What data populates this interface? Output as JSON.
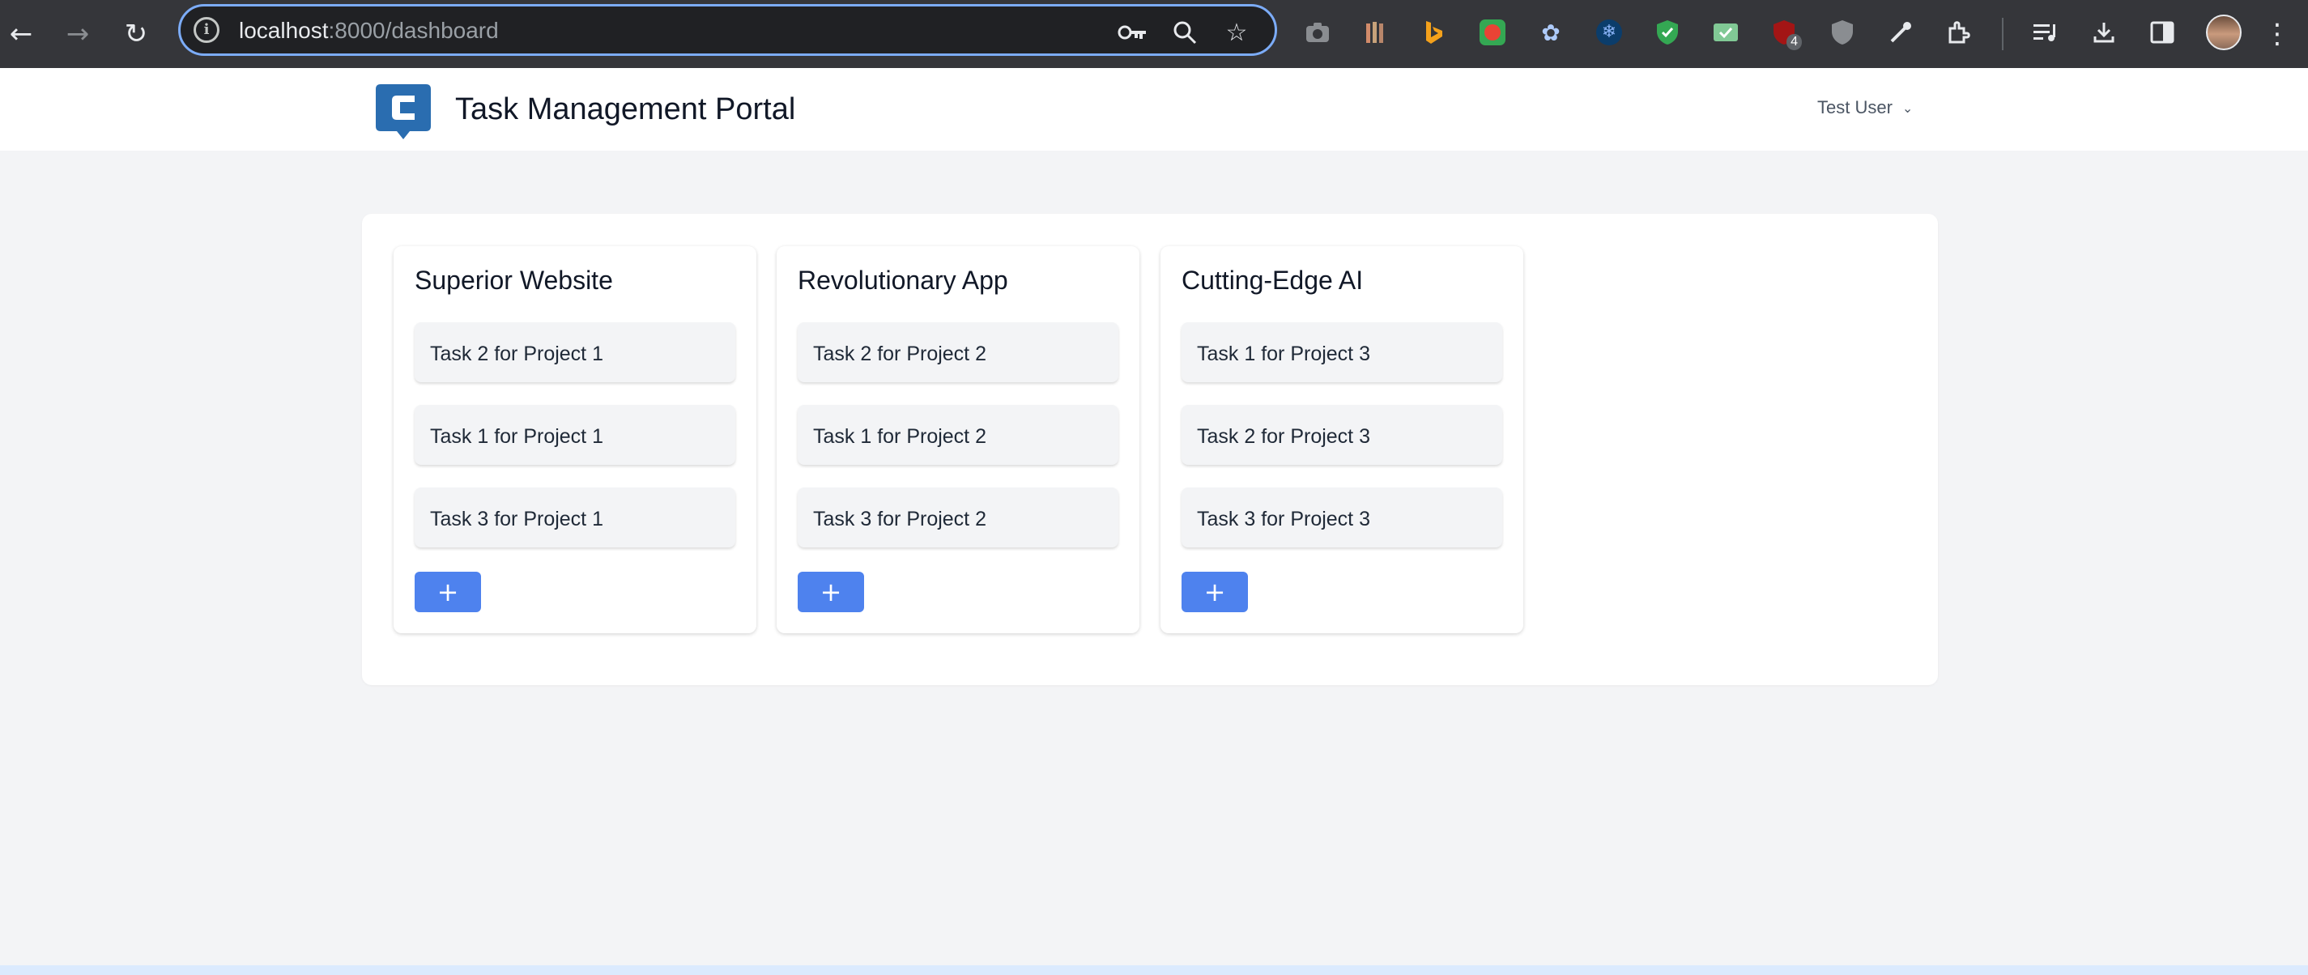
{
  "browser": {
    "url_host": "localhost",
    "url_path": ":8000/dashboard",
    "extension_badge": "4"
  },
  "header": {
    "title": "Task Management Portal",
    "user_name": "Test User",
    "brand_color": "#2a6db0"
  },
  "board": {
    "add_label": "+",
    "accent_color": "#4e82ee",
    "columns": [
      {
        "title": "Superior Website",
        "tasks": [
          "Task 2 for Project 1",
          "Task 1 for Project 1",
          "Task 3 for Project 1"
        ]
      },
      {
        "title": "Revolutionary App",
        "tasks": [
          "Task 2 for Project 2",
          "Task 1 for Project 2",
          "Task 3 for Project 2"
        ]
      },
      {
        "title": "Cutting-Edge AI",
        "tasks": [
          "Task 1 for Project 3",
          "Task 2 for Project 3",
          "Task 3 for Project 3"
        ]
      }
    ]
  }
}
